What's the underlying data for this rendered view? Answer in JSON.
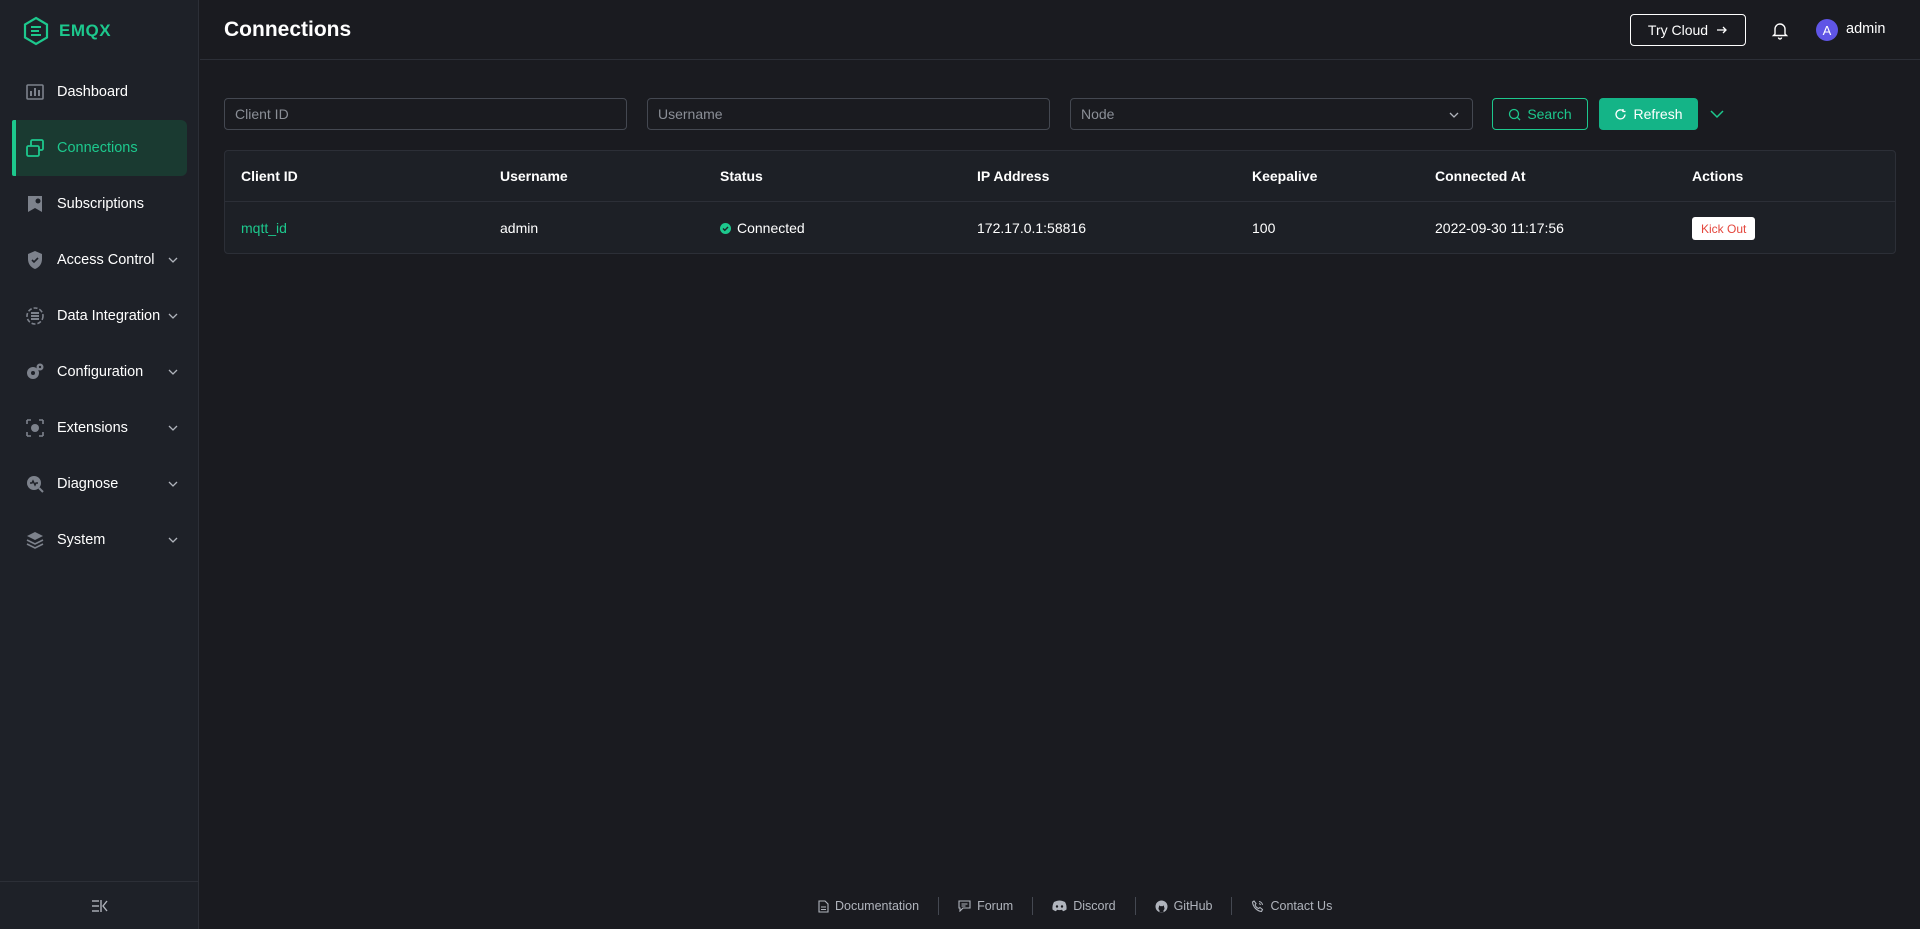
{
  "app": {
    "name": "EMQX"
  },
  "sidebar": {
    "items": [
      {
        "label": "Dashboard",
        "icon": "dashboard-icon",
        "expandable": false,
        "active": false
      },
      {
        "label": "Connections",
        "icon": "connections-icon",
        "expandable": false,
        "active": true
      },
      {
        "label": "Subscriptions",
        "icon": "subscriptions-icon",
        "expandable": false,
        "active": false
      },
      {
        "label": "Access Control",
        "icon": "shield-icon",
        "expandable": true,
        "active": false
      },
      {
        "label": "Data Integration",
        "icon": "data-integration-icon",
        "expandable": true,
        "active": false
      },
      {
        "label": "Configuration",
        "icon": "gears-icon",
        "expandable": true,
        "active": false
      },
      {
        "label": "Extensions",
        "icon": "extensions-icon",
        "expandable": true,
        "active": false
      },
      {
        "label": "Diagnose",
        "icon": "diagnose-icon",
        "expandable": true,
        "active": false
      },
      {
        "label": "System",
        "icon": "system-icon",
        "expandable": true,
        "active": false
      }
    ]
  },
  "header": {
    "title": "Connections",
    "try_cloud_label": "Try Cloud",
    "user_initial": "A",
    "username": "admin"
  },
  "filters": {
    "client_id_placeholder": "Client ID",
    "username_placeholder": "Username",
    "node_placeholder": "Node",
    "search_label": "Search",
    "refresh_label": "Refresh"
  },
  "table": {
    "columns": [
      "Client ID",
      "Username",
      "Status",
      "IP Address",
      "Keepalive",
      "Connected At",
      "Actions"
    ],
    "rows": [
      {
        "client_id": "mqtt_id",
        "username": "admin",
        "status": "Connected",
        "ip_address": "172.17.0.1:58816",
        "keepalive": "100",
        "connected_at": "2022-09-30 11:17:56",
        "action": "Kick Out"
      }
    ]
  },
  "footer": {
    "links": [
      "Documentation",
      "Forum",
      "Discord",
      "GitHub",
      "Contact Us"
    ]
  },
  "colors": {
    "accent": "#1dc88d",
    "background": "#1a1b20",
    "sidebar": "#1e2128",
    "danger": "#e4463c",
    "avatar": "#5f55e6"
  }
}
